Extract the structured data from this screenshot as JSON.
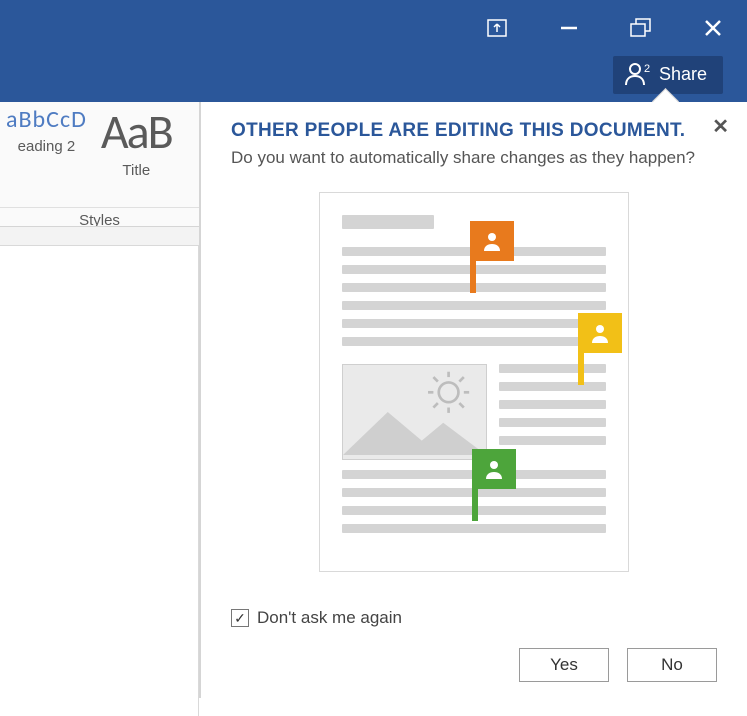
{
  "titlebar": {
    "upload_icon": "upload-icon",
    "minimize_icon": "minimize-icon",
    "restore_icon": "restore-icon",
    "close_icon": "close-icon"
  },
  "share": {
    "label": "Share",
    "badge": "2"
  },
  "styles": {
    "group_label": "Styles",
    "tiles": [
      {
        "sample": "aBbCcD",
        "label": "eading 2"
      },
      {
        "sample": "AaB",
        "label": "Title"
      }
    ]
  },
  "popup": {
    "heading": "OTHER PEOPLE ARE EDITING THIS DOCUMENT.",
    "subheading": "Do you want to automatically share changes as they happen?",
    "checkbox_label": "Don't ask me again",
    "checkbox_checked": true,
    "buttons": {
      "yes": "Yes",
      "no": "No"
    },
    "flags": [
      {
        "color": "orange"
      },
      {
        "color": "yellow"
      },
      {
        "color": "green"
      }
    ]
  }
}
